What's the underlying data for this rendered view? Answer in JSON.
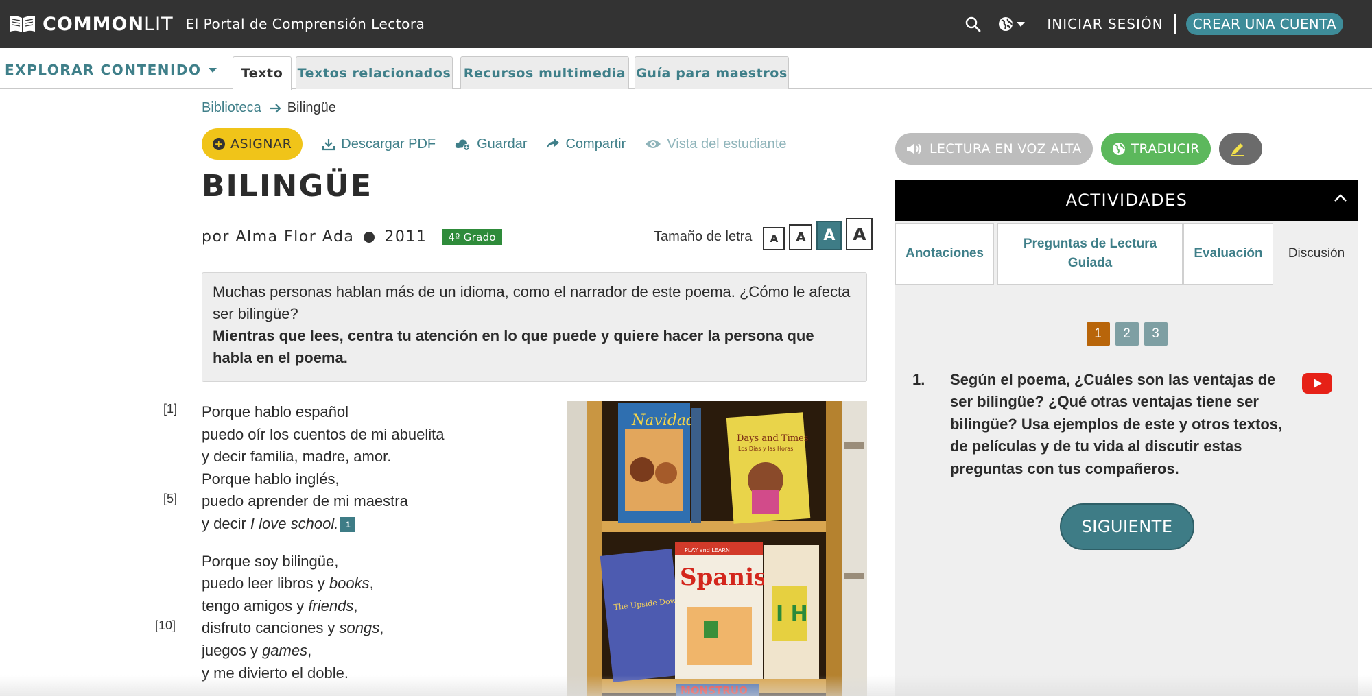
{
  "header": {
    "brand_bold": "COMMON",
    "brand_light": "LIT",
    "tagline": "El Portal de Comprensión Lectora",
    "login": "INICIAR SESIÓN",
    "signup": "CREAR UNA CUENTA"
  },
  "nav": {
    "explore": "EXPLORAR CONTENIDO",
    "tabs": [
      {
        "label": "Texto",
        "active": true
      },
      {
        "label": "Textos relacionados"
      },
      {
        "label": "Recursos multimedia"
      },
      {
        "label": "Guía para maestros"
      }
    ]
  },
  "breadcrumb": {
    "root": "Biblioteca",
    "current": "Bilingüe"
  },
  "actions": {
    "assign": "ASIGNAR",
    "download": "Descargar PDF",
    "save": "Guardar",
    "share": "Compartir",
    "student_view": "Vista del estudiante"
  },
  "text": {
    "title": "BILINGÜE",
    "author": "por Alma Flor Ada",
    "year": "2011",
    "grade": "4º Grado",
    "font_size_label": "Tamaño de letra",
    "font_sizes": [
      "A",
      "A",
      "A",
      "A"
    ],
    "active_font_size_index": 2,
    "intro_line": "Muchas personas hablan más de un idioma, como el narrador de este poema. ¿Cómo le afecta ser bilingüe?",
    "intro_focus": "Mientras que lees, centra tu atención en lo que puede y quiere hacer la persona que habla en el poema."
  },
  "poem": {
    "line_numbers": {
      "first": "[1]",
      "fifth": "[5]",
      "tenth": "[10]"
    },
    "stanza1": {
      "l1": "Porque hablo español",
      "l2": "puedo oír los cuentos de mi abuelita",
      "l3": "y decir familia, madre, amor.",
      "l4": "Porque hablo inglés,",
      "l5": "puedo aprender de mi maestra",
      "l6_a": "y decir ",
      "l6_b": "I love school.",
      "footnote": "1"
    },
    "stanza2": {
      "l1": "Porque soy bilingüe,",
      "l2_a": "puedo leer libros y ",
      "l2_b": "books",
      "l3_a": "tengo amigos y ",
      "l3_b": "friends",
      "l4_a": "disfruto canciones y ",
      "l4_b": "songs",
      "l5_a": "juegos y ",
      "l5_b": "games",
      "l6": "y me divierto el doble."
    },
    "image": {
      "book1": "Navidad",
      "book2": "Days and Times",
      "book2_sub": "Los Días y las Horas",
      "book3": "Spanish",
      "book3_top": "PLAY and LEARN",
      "book4": "The Upside Down",
      "book5_letters": "I  H",
      "book6": "MONSTRUO"
    }
  },
  "right_panel": {
    "read_aloud": "LECTURA EN VOZ ALTA",
    "translate": "TRADUCIR",
    "activities": "ACTIVIDADES",
    "tabs": [
      "Anotaciones",
      "Preguntas de Lectura Guiada",
      "Evaluación",
      "Discusión"
    ],
    "active_tab_index": 3,
    "pages": [
      "1",
      "2",
      "3"
    ],
    "active_page_index": 0,
    "question_number": "1.",
    "question": "Según el poema, ¿Cuáles son las ventajas de ser bilingüe? ¿Qué otras ventajas tiene ser bilingüe? Usa ejemplos de este y otros textos, de películas y de tu vida al discutir estas preguntas con tus compañeros.",
    "next": "SIGUIENTE"
  },
  "colors": {
    "topbar": "#333333",
    "teal": "#3f7f89",
    "assign_yellow": "#f0c419",
    "grade_green": "#2e8b3a",
    "translate_green": "#5cb85c",
    "active_page": "#b8650a"
  }
}
